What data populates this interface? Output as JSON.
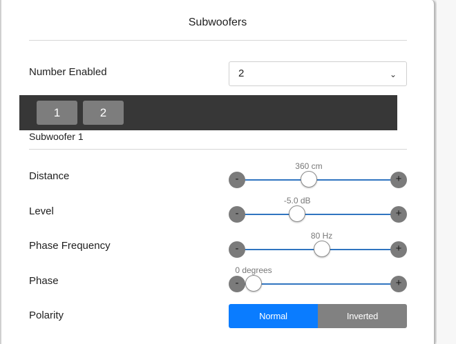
{
  "dialog": {
    "title": "Subwoofers"
  },
  "number_enabled": {
    "label": "Number Enabled",
    "value": "2"
  },
  "tabs": [
    {
      "label": "1"
    },
    {
      "label": "2"
    }
  ],
  "section": {
    "title": "Subwoofer 1"
  },
  "sliders": [
    {
      "label": "Distance",
      "value_text": "360 cm",
      "fraction": 0.43
    },
    {
      "label": "Level",
      "value_text": "-5.0 dB",
      "fraction": 0.34
    },
    {
      "label": "Phase Frequency",
      "value_text": "80 Hz",
      "fraction": 0.53
    },
    {
      "label": "Phase",
      "value_text": "0 degrees",
      "fraction": 0.0
    }
  ],
  "controls": {
    "minus": "-",
    "plus": "+"
  },
  "polarity": {
    "label": "Polarity",
    "options": [
      "Normal",
      "Inverted"
    ],
    "selected": "Normal"
  },
  "colors": {
    "accent": "#0a7cff",
    "track": "#2f74c0",
    "tabbar": "#373737"
  }
}
